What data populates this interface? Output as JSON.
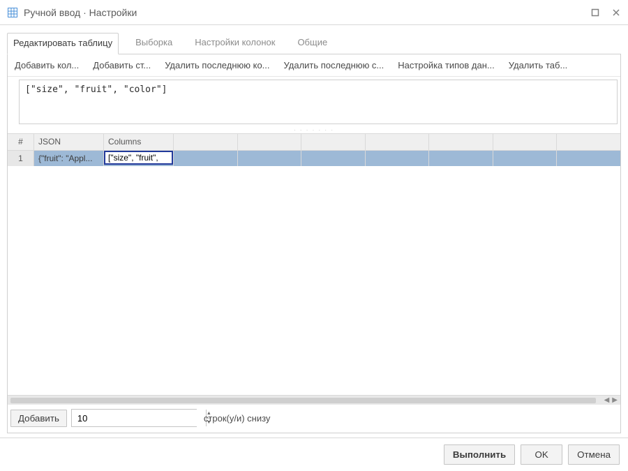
{
  "window": {
    "title": "Ручной ввод · Настройки"
  },
  "tabs": [
    {
      "label": "Редактировать таблицу",
      "active": true
    },
    {
      "label": "Выборка",
      "active": false
    },
    {
      "label": "Настройки колонок",
      "active": false
    },
    {
      "label": "Общие",
      "active": false
    }
  ],
  "actions": {
    "add_column": "Добавить кол...",
    "add_row": "Добавить ст...",
    "delete_last_column": "Удалить последнюю ко...",
    "delete_last_row": "Удалить последнюю с...",
    "configure_types": "Настройка типов дан...",
    "delete_table": "Удалить таб..."
  },
  "editor": {
    "content": "[\"size\", \"fruit\", \"color\"]"
  },
  "grid": {
    "headers": {
      "index": "#",
      "json": "JSON",
      "columns": "Columns"
    },
    "rows": [
      {
        "index": "1",
        "json": "{\"fruit\": \"Appl...",
        "columns_editing": "[\"size\", \"fruit\","
      }
    ]
  },
  "addrows": {
    "button": "Добавить",
    "count": "10",
    "suffix": "строк(у/и) снизу"
  },
  "footer": {
    "run": "Выполнить",
    "ok": "OK",
    "cancel": "Отмена"
  }
}
